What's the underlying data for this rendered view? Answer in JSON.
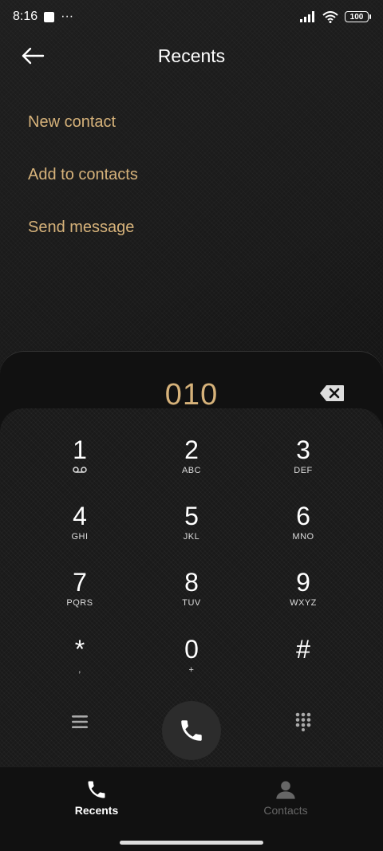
{
  "status": {
    "time": "8:16",
    "dots": "···",
    "battery": "100"
  },
  "header": {
    "title": "Recents"
  },
  "options": [
    {
      "label": "New contact"
    },
    {
      "label": "Add to contacts"
    },
    {
      "label": "Send message"
    }
  ],
  "dialer": {
    "number": "010"
  },
  "keys": [
    {
      "digit": "1",
      "letters": ""
    },
    {
      "digit": "2",
      "letters": "ABC"
    },
    {
      "digit": "3",
      "letters": "DEF"
    },
    {
      "digit": "4",
      "letters": "GHI"
    },
    {
      "digit": "5",
      "letters": "JKL"
    },
    {
      "digit": "6",
      "letters": "MNO"
    },
    {
      "digit": "7",
      "letters": "PQRS"
    },
    {
      "digit": "8",
      "letters": "TUV"
    },
    {
      "digit": "9",
      "letters": "WXYZ"
    },
    {
      "digit": "*",
      "letters": ","
    },
    {
      "digit": "0",
      "letters": "+"
    },
    {
      "digit": "#",
      "letters": ""
    }
  ],
  "nav": {
    "recents": "Recents",
    "contacts": "Contacts"
  },
  "colors": {
    "accent": "#d6b27a",
    "inactive": "#666666"
  }
}
